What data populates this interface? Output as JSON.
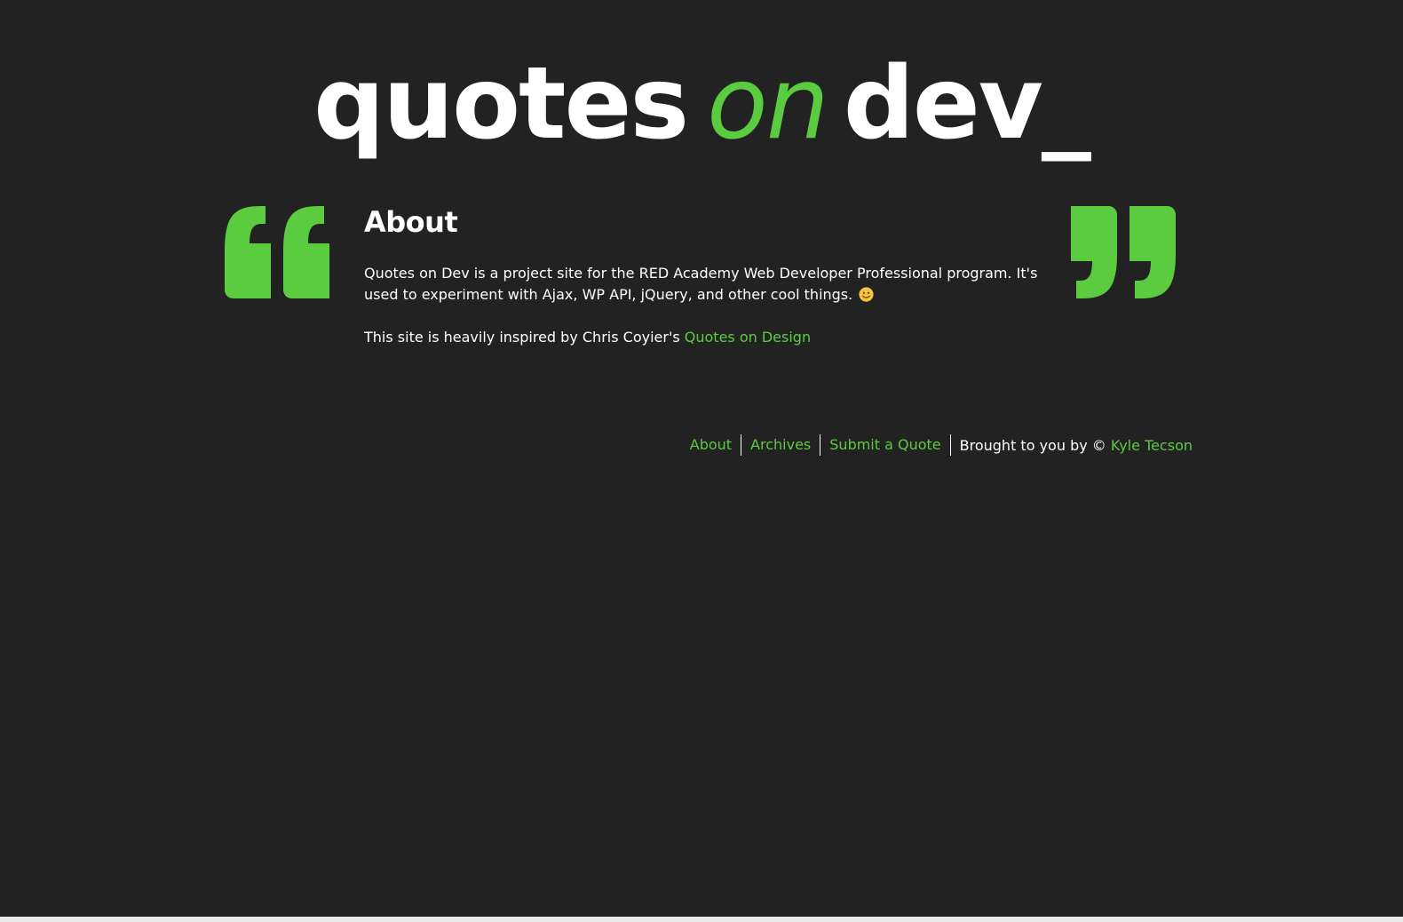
{
  "header": {
    "title_word1": "quotes",
    "title_word2": "on",
    "title_word3": "dev_"
  },
  "page": {
    "heading": "About",
    "paragraph1": "Quotes on Dev is a project site for the RED Academy Web Developer Professional program. It's used to experiment with Ajax, WP API, jQuery, and other cool things.",
    "paragraph2_text": "This site is heavily inspired by Chris Coyier's ",
    "paragraph2_link": "Quotes on Design"
  },
  "footer": {
    "nav": [
      {
        "label": "About"
      },
      {
        "label": "Archives"
      },
      {
        "label": "Submit a Quote"
      }
    ],
    "credit_text": "Brought to you by © ",
    "credit_link": "Kyle Tecson"
  },
  "icons": {
    "quote_open": "left-double-quote-icon",
    "quote_close": "right-double-quote-icon",
    "emoji": "smiley-face-icon"
  },
  "colors": {
    "background": "#222222",
    "accent": "#5bcc3f",
    "text": "#ffffff"
  }
}
